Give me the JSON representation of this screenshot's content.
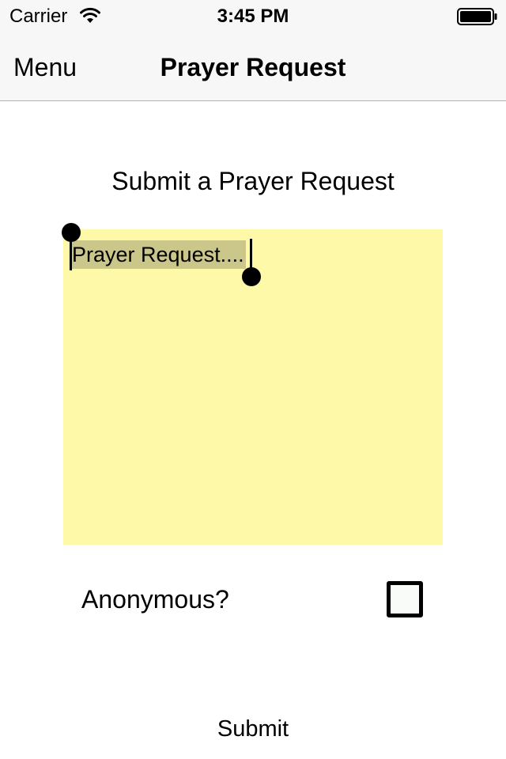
{
  "status_bar": {
    "carrier": "Carrier",
    "time": "3:45 PM",
    "wifi_icon": "wifi-icon",
    "battery_icon": "battery-icon"
  },
  "nav": {
    "menu_label": "Menu",
    "title": "Prayer Request"
  },
  "form": {
    "heading": "Submit a Prayer Request",
    "request_text": "Prayer Request....",
    "note_color": "#fef8a9",
    "selection_color": "#cbc68a",
    "anonymous_label": "Anonymous?",
    "anonymous_checked": false,
    "submit_label": "Submit"
  }
}
